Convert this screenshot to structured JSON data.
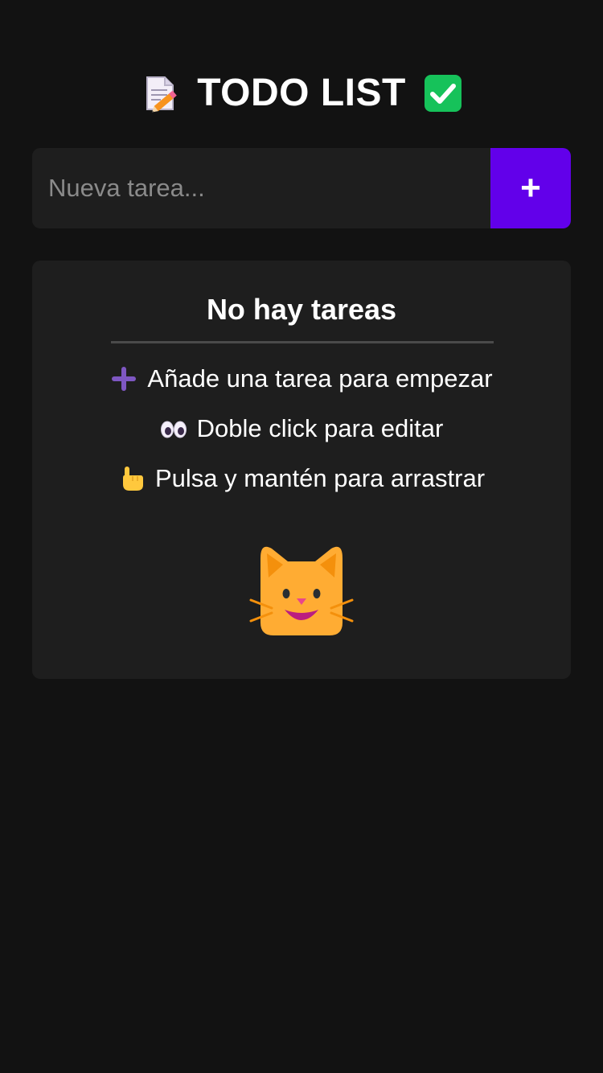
{
  "header": {
    "title": "TODO LIST",
    "left_icon": "memo-icon",
    "right_icon": "check-mark-button-icon"
  },
  "new_task": {
    "placeholder": "Nueva tarea...",
    "value": "",
    "add_button_label": "+"
  },
  "empty_state": {
    "title": "No hay tareas",
    "hints": [
      {
        "icon": "plus-icon",
        "text": "Añade una tarea para empezar"
      },
      {
        "icon": "eyes-icon",
        "text": "Doble click para editar"
      },
      {
        "icon": "pointing-hand-icon",
        "text": "Pulsa y mantén para arrastrar"
      }
    ],
    "illustration": "smiling-cat-icon"
  },
  "colors": {
    "background": "#121212",
    "surface": "#1e1e1e",
    "accent": "#6200ea",
    "text": "#ffffff",
    "placeholder": "#8a8a8a"
  }
}
